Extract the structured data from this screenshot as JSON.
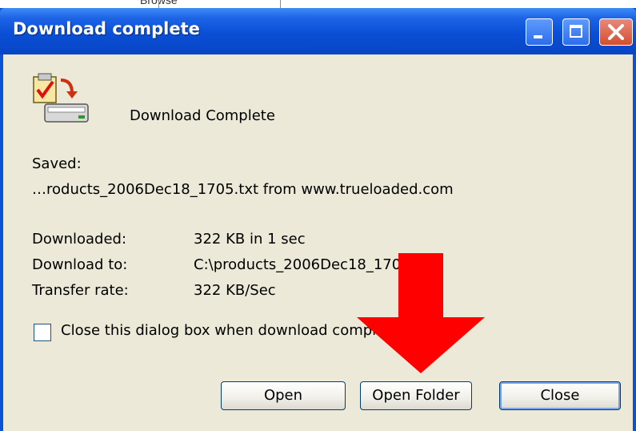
{
  "background": {
    "sliver_text": "Browse",
    "colors": {
      "titlebar": "#0a53d8",
      "client": "#ece9d8",
      "arrow": "#ff0000"
    }
  },
  "window": {
    "title": "Download complete",
    "controls": {
      "minimize": "minimize-icon",
      "maximize": "maximize-icon",
      "close": "close-icon"
    }
  },
  "dialog": {
    "icon": "download-complete-icon",
    "headline": "Download Complete",
    "saved_label": "Saved:",
    "saved_value": "…roducts_2006Dec18_1705.txt from www.trueloaded.com",
    "details": [
      {
        "label": "Downloaded:",
        "value": "322 KB in 1 sec"
      },
      {
        "label": "Download to:",
        "value": "C:\\products_2006Dec18_1705.txt"
      },
      {
        "label": "Transfer rate:",
        "value": "322 KB/Sec"
      }
    ],
    "checkbox_label": "Close this dialog box when download completes",
    "checkbox_checked": false
  },
  "buttons": {
    "open": "Open",
    "open_folder": "Open Folder",
    "close": "Close"
  },
  "annotation": {
    "type": "red-arrow",
    "points_to": "Open Folder"
  }
}
